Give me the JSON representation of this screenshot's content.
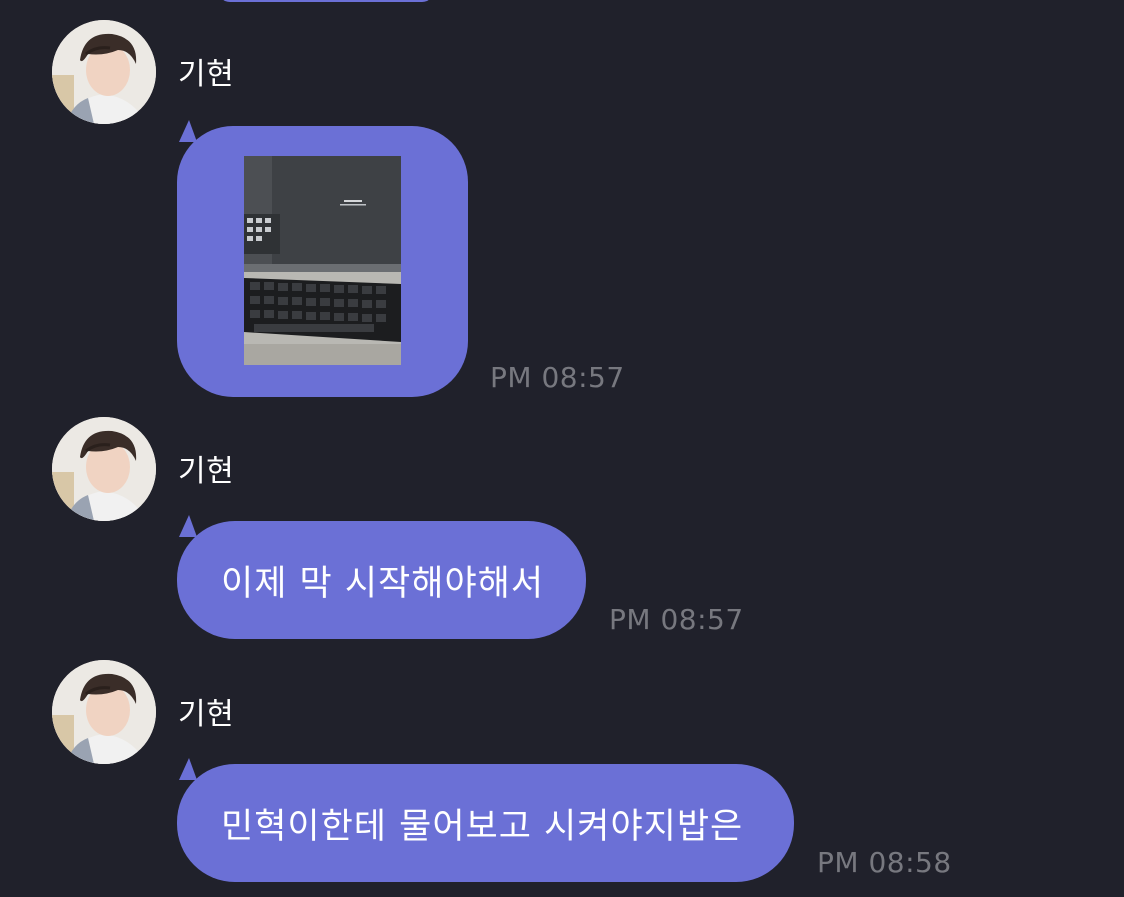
{
  "chat": {
    "messages": [
      {
        "sender": "기현",
        "type": "image",
        "timestamp": "PM 08:57",
        "image_description_icon": "laptop-photo"
      },
      {
        "sender": "기현",
        "type": "text",
        "text": "이제 막 시작해야해서",
        "timestamp": "PM 08:57"
      },
      {
        "sender": "기현",
        "type": "text",
        "text": "민혁이한테 물어보고 시켜야지밥은",
        "timestamp": "PM 08:58"
      }
    ]
  },
  "colors": {
    "background": "#20212b",
    "bubble": "#6b70d6",
    "timestamp": "#77787f",
    "name": "#ffffff"
  }
}
